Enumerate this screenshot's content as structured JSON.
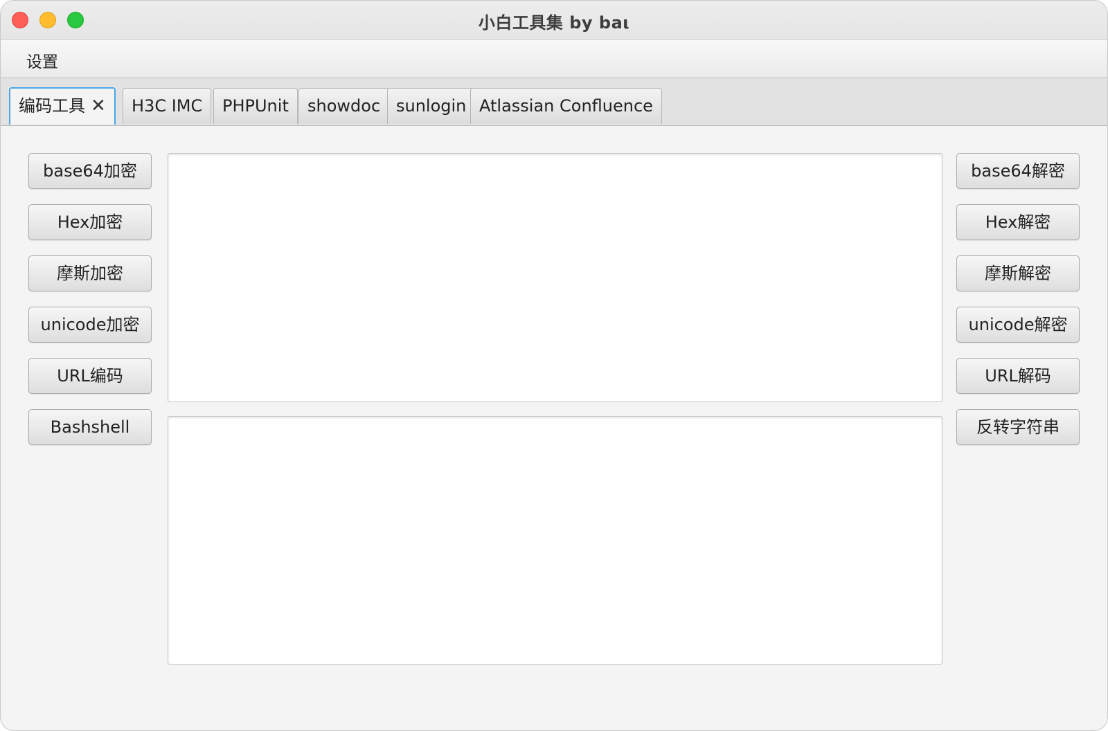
{
  "window": {
    "title": "小白工具集  by baι"
  },
  "menubar": {
    "items": [
      {
        "label": "设置"
      }
    ]
  },
  "tabs": [
    {
      "label": "编码工具",
      "active": true,
      "closable": true,
      "close_glyph": "✕"
    },
    {
      "label": "H3C IMC"
    },
    {
      "label": "PHPUnit"
    },
    {
      "label": "showdoc"
    },
    {
      "label": "sunlogin"
    },
    {
      "label": "Atlassian Confluence"
    }
  ],
  "left_buttons": [
    {
      "label": "base64加密"
    },
    {
      "label": "Hex加密"
    },
    {
      "label": "摩斯加密"
    },
    {
      "label": "unicode加密"
    },
    {
      "label": "URL编码"
    },
    {
      "label": "Bashshell"
    }
  ],
  "right_buttons": [
    {
      "label": "base64解密"
    },
    {
      "label": "Hex解密"
    },
    {
      "label": "摩斯解密"
    },
    {
      "label": "unicode解密"
    },
    {
      "label": "URL解码"
    },
    {
      "label": "反转字符串"
    }
  ],
  "input_area": {
    "value": ""
  },
  "output_area": {
    "value": ""
  },
  "colors": {
    "traffic_close": "#fe5f57",
    "traffic_minimize": "#febc2e",
    "traffic_maximize": "#28c840",
    "active_tab_border": "#4aa6e8"
  }
}
